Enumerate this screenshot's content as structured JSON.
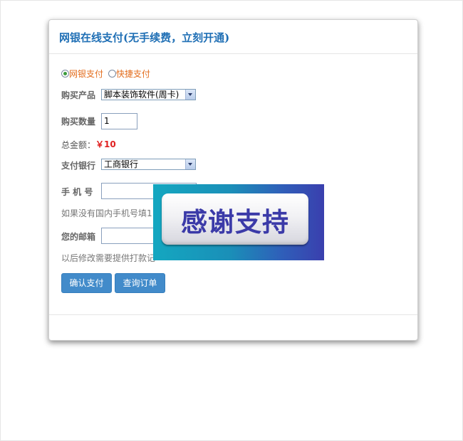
{
  "panel": {
    "title": "网银在线支付(无手续费，立刻开通)"
  },
  "payment_method": {
    "options": [
      {
        "label": "网银支付",
        "selected": true
      },
      {
        "label": "快捷支付",
        "selected": false
      }
    ]
  },
  "product": {
    "label": "购买产品",
    "selected": "脚本装饰软件(周卡)"
  },
  "quantity": {
    "label": "购买数量",
    "value": "1"
  },
  "total": {
    "label": "总金额：",
    "amount": "￥10"
  },
  "bank": {
    "label": "支付银行",
    "selected": "工商银行"
  },
  "phone": {
    "label": "手 机 号",
    "value": "",
    "hint": "如果没有国内手机号填1"
  },
  "email": {
    "label": "您的邮箱",
    "value": "",
    "hint": "以后修改需要提供打款记"
  },
  "actions": {
    "confirm_label": "确认支付",
    "query_label": "查询订单"
  },
  "overlay": {
    "text": "感谢支持"
  },
  "colors": {
    "title": "#1f6fb5",
    "radio_label": "#e36c1c",
    "amount": "#e02020",
    "button": "#428bca"
  }
}
